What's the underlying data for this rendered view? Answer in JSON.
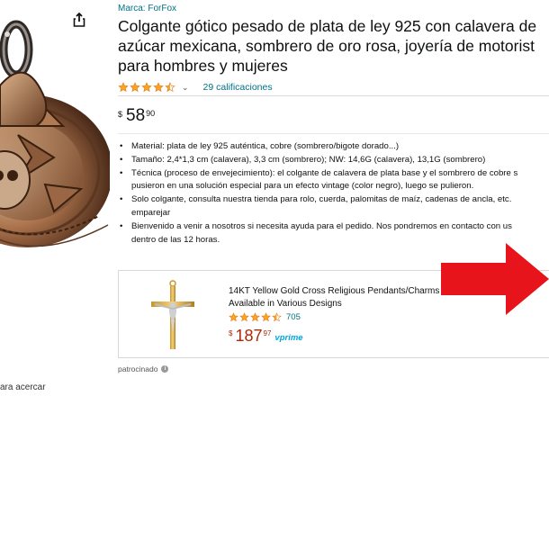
{
  "product": {
    "brand": "Marca: ForFox",
    "title_lines": [
      "Colgante gótico pesado de plata de ley 925 con calavera de",
      "azúcar mexicana, sombrero de oro rosa, joyería de motorist",
      "para hombres y mujeres"
    ],
    "rating": 4.5,
    "rating_count": "29 calificaciones",
    "price": {
      "currency": "$",
      "whole": "58",
      "fraction": "90"
    },
    "bullets": [
      "Material: plata de ley 925 auténtica, cobre (sombrero/bigote dorado...)",
      "Tamaño: 2,4*1,3 cm (calavera), 3,3 cm (sombrero); NW: 14,6G (calavera), 13,1G (sombrero)",
      "Técnica (proceso de envejecimiento): el colgante de calavera de plata base y el sombrero de cobre s",
      "pusieron en una solución especial para un efecto vintage (color negro), luego se pulieron.",
      "Solo colgante, consulta nuestra tienda para rolo, cuerda, palomitas de maíz, cadenas de ancla, etc.",
      "emparejar",
      "Bienvenido a venir a nosotros si necesita ayuda para el pedido. Nos pondremos en contacto con us",
      "dentro de las 12 horas."
    ],
    "bullet_continuations": [
      3,
      5,
      7
    ],
    "zoom_hint": "ara acercar"
  },
  "sponsored_card": {
    "title_lines": [
      "14KT Yellow Gold Cross Religious Pendants/Charms fo",
      "Available in Various Designs"
    ],
    "rating": 4.5,
    "rating_count": "705",
    "price": {
      "currency": "$",
      "whole": "187",
      "fraction": "97"
    },
    "prime_label": "vprime",
    "sponsored_label": "patrocinado"
  },
  "colors": {
    "link": "#007185",
    "star": "#ffa41c",
    "price_red": "#b12704",
    "arrow_red": "#e8141b",
    "prime_blue": "#00a8e1"
  }
}
